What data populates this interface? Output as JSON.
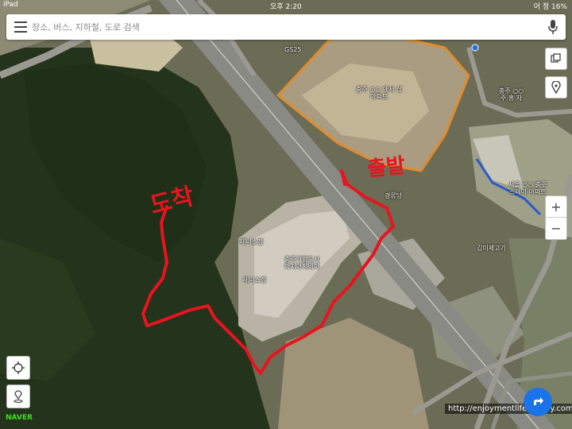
{
  "status_bar": {
    "device": "iPad",
    "time": "오후 2:20",
    "right_text": "어 정 16%"
  },
  "search": {
    "placeholder": "장소, 버스, 지하철, 도로 검색"
  },
  "labels": {
    "gs25": "GS25",
    "apt_north": "충주 ○○ 에서 상\n아파트",
    "apt_east": "충주 ○○\n주 흥 자",
    "apt_southeast": "서울 ○○ 충주\n스테이 아파트",
    "gyeongnyu": "경류당",
    "daemi": "김미제고기",
    "tennis_1": "테니스장",
    "tennis_2": "테니스장",
    "library": "충주기업도시\n마치아지비이"
  },
  "annotations": {
    "arrival": "도착",
    "departure": "출발"
  },
  "watermark": {
    "provider": "NAVER",
    "url": "http://enjoymentlife.tistory.com"
  },
  "colors": {
    "route": "#e8141e",
    "naver_green": "#3ee01f",
    "nav_blue": "#1a73e8"
  },
  "controls": {
    "zoom_in": "+",
    "zoom_out": "−"
  }
}
